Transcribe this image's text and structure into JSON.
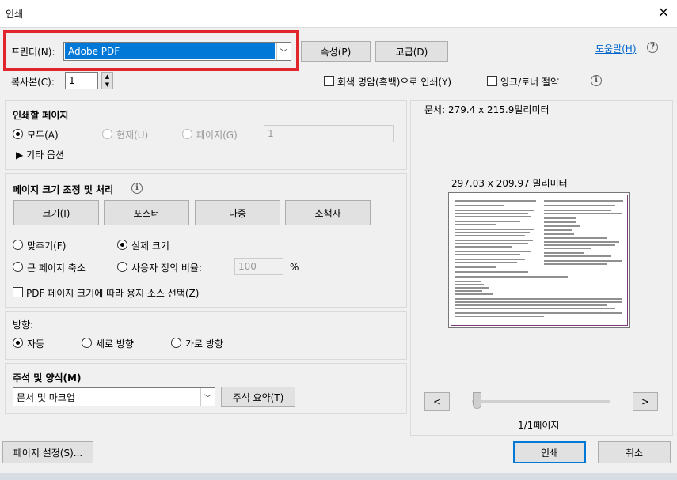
{
  "window": {
    "title": "인쇄",
    "close": "×"
  },
  "printer": {
    "label": "프린터(N):",
    "selected": "Adobe PDF",
    "properties_button": "속성(P)",
    "advanced_button": "고급(D)",
    "help_link": "도움말(H)",
    "help_icon": "?"
  },
  "copies": {
    "label": "복사본(C):",
    "value": "1",
    "grayscale_label": "회색 명암(흑백)으로 인쇄(Y)",
    "save_ink_label": "잉크/토너 절약",
    "info_icon": "i"
  },
  "pages_to_print": {
    "heading": "인쇄할 페이지",
    "all": "모두(A)",
    "current": "현재(U)",
    "pages": "페이지(G)",
    "pages_value": "1",
    "more_options": "▶ 기타 옵션"
  },
  "sizing": {
    "heading": "페이지 크기 조정 및 처리",
    "info_icon": "i",
    "buttons": [
      "크기(I)",
      "포스터",
      "다중",
      "소책자"
    ],
    "fit": "맞추기(F)",
    "actual_size": "실제 크기",
    "shrink": "큰 페이지 축소",
    "custom_scale": "사용자 정의 비율:",
    "scale_value": "100",
    "percent": "%",
    "choose_source": "PDF 페이지 크기에 따라 용지 소스 선택(Z)"
  },
  "orientation": {
    "heading": "방향:",
    "auto": "자동",
    "portrait": "세로 방향",
    "landscape": "가로 방향"
  },
  "comments": {
    "heading": "주석 및 양식(M)",
    "selected": "문서 및 마크업",
    "summary_button": "주석 요약(T)"
  },
  "preview": {
    "doc_size": "문서: 279.4 x 215.9밀리미터",
    "paper_size": "297.03 x 209.97 밀리미터",
    "prev": "<",
    "next": ">",
    "page_indicator": "1/1페이지"
  },
  "footer": {
    "page_setup": "페이지 설정(S)...",
    "print": "인쇄",
    "cancel": "취소"
  },
  "colors": {
    "highlight": "#e0262c",
    "selected_bg": "#0078d7",
    "link": "#0066cc"
  }
}
